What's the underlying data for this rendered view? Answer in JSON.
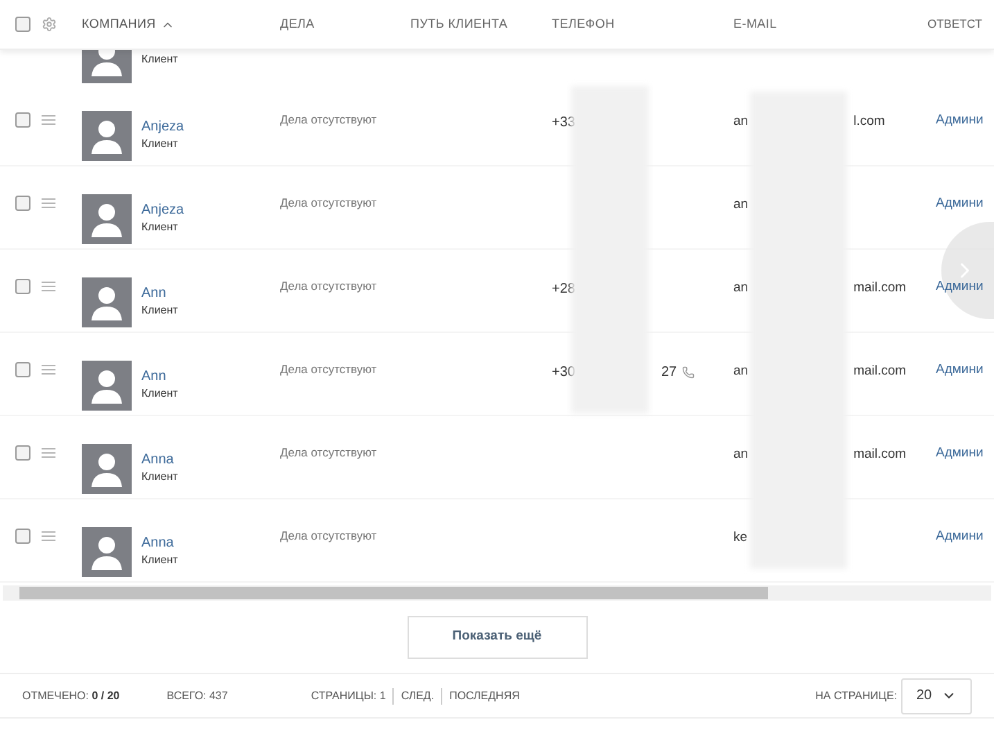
{
  "header": {
    "select_all_checked": false,
    "columns": [
      {
        "label": "КОМПАНИЯ",
        "sorted": true
      },
      {
        "label": "ДЕЛА",
        "sorted": false
      },
      {
        "label": "ПУТЬ КЛИЕНТА",
        "sorted": false
      },
      {
        "label": "ТЕЛЕФОН",
        "sorted": false
      },
      {
        "label": "E-MAIL",
        "sorted": false
      },
      {
        "label": "ОТВЕТСТ",
        "sorted": false
      }
    ]
  },
  "partial_row": {
    "type": "Клиент"
  },
  "rows": [
    {
      "checked": false,
      "name": "Anjeza",
      "type": "Клиент",
      "tasks": "Дела отсутствуют",
      "phone_start": "+33",
      "phone_end": "",
      "call_icon": false,
      "email_start": "an",
      "email_end": "l.com",
      "responsible": "Админи"
    },
    {
      "checked": false,
      "name": "Anjeza",
      "type": "Клиент",
      "tasks": "Дела отсутствуют",
      "phone_start": "",
      "phone_end": "",
      "call_icon": false,
      "email_start": "an",
      "email_end": "",
      "responsible": "Админи"
    },
    {
      "checked": false,
      "name": "Ann",
      "type": "Клиент",
      "tasks": "Дела отсутствуют",
      "phone_start": "+28",
      "phone_end": "",
      "call_icon": false,
      "email_start": "an",
      "email_end": "mail.com",
      "responsible": "Админи"
    },
    {
      "checked": false,
      "name": "Ann",
      "type": "Клиент",
      "tasks": "Дела отсутствуют",
      "phone_start": "+30",
      "phone_end": "27",
      "call_icon": true,
      "email_start": "an",
      "email_end": "mail.com",
      "responsible": "Админи"
    },
    {
      "checked": false,
      "name": "Anna",
      "type": "Клиент",
      "tasks": "Дела отсутствуют",
      "phone_start": "",
      "phone_end": "",
      "call_icon": false,
      "email_start": "an",
      "email_end": "mail.com",
      "responsible": "Админи"
    },
    {
      "checked": false,
      "name": "Anna",
      "type": "Клиент",
      "tasks": "Дела отсутствуют",
      "phone_start": "",
      "phone_end": "",
      "call_icon": false,
      "email_start": "ke",
      "email_end": "",
      "responsible": "Админи"
    }
  ],
  "show_more": "Показать ещё",
  "footer": {
    "selected_label": "ОТМЕЧЕНО:",
    "selected_value": "0 / 20",
    "total": "ВСЕГО: 437",
    "pages_label": "СТРАНИЦЫ: 1",
    "next": "СЛЕД.",
    "last": "ПОСЛЕДНЯЯ",
    "per_page_label": "НА СТРАНИЦЕ:",
    "per_page": "20"
  }
}
